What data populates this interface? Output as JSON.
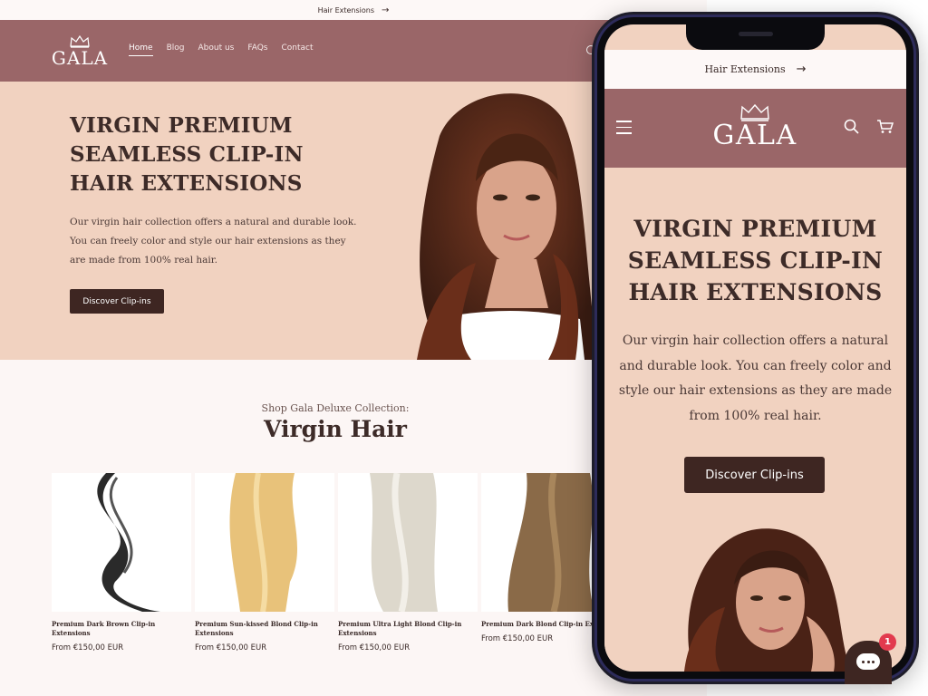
{
  "announcement": {
    "text": "Hair Extensions",
    "arrow": "→"
  },
  "brand": {
    "name": "GALA",
    "accent": "#9a6668",
    "button_color": "#3e2622",
    "hero_bg": "#f1d2c0"
  },
  "nav": {
    "items": [
      "Home",
      "Blog",
      "About us",
      "FAQs",
      "Contact"
    ],
    "active": "Home"
  },
  "hero": {
    "title": "VIRGIN PREMIUM SEAMLESS CLIP-IN HAIR EXTENSIONS",
    "description": "Our virgin hair collection offers a natural and durable look. You can freely color and style our hair extensions as they are made from 100% real hair.",
    "button": "Discover Clip-ins"
  },
  "collection": {
    "subtitle": "Shop Gala Deluxe Collection:",
    "title": "Virgin Hair",
    "products": [
      {
        "name": "Premium Dark Brown Clip-in Extensions",
        "price": "From €150,00 EUR",
        "color": "#2a2a2a"
      },
      {
        "name": "Premium Sun-kissed Blond Clip-in Extensions",
        "price": "From €150,00 EUR",
        "color": "#e8c27a"
      },
      {
        "name": "Premium Ultra Light Blond Clip-in Extensions",
        "price": "From €150,00 EUR",
        "color": "#ddd8cc"
      },
      {
        "name": "Premium Dark Blond Clip-in Ex",
        "price": "From €150,00 EUR",
        "color": "#8a6a48"
      }
    ]
  },
  "mobile": {
    "announcement": "Hair Extensions",
    "hero_title": "VIRGIN PREMIUM SEAMLESS CLIP-IN HAIR EXTENSIONS",
    "hero_description": "Our virgin hair collection offers a natural and durable look. You can freely color and style our hair extensions as they are made from 100% real hair.",
    "button": "Discover Clip-ins"
  },
  "chat": {
    "badge_count": "1"
  },
  "icons": [
    "crown-icon",
    "arrow-right-icon",
    "search-icon",
    "menu-icon",
    "cart-icon",
    "chat-icon"
  ]
}
